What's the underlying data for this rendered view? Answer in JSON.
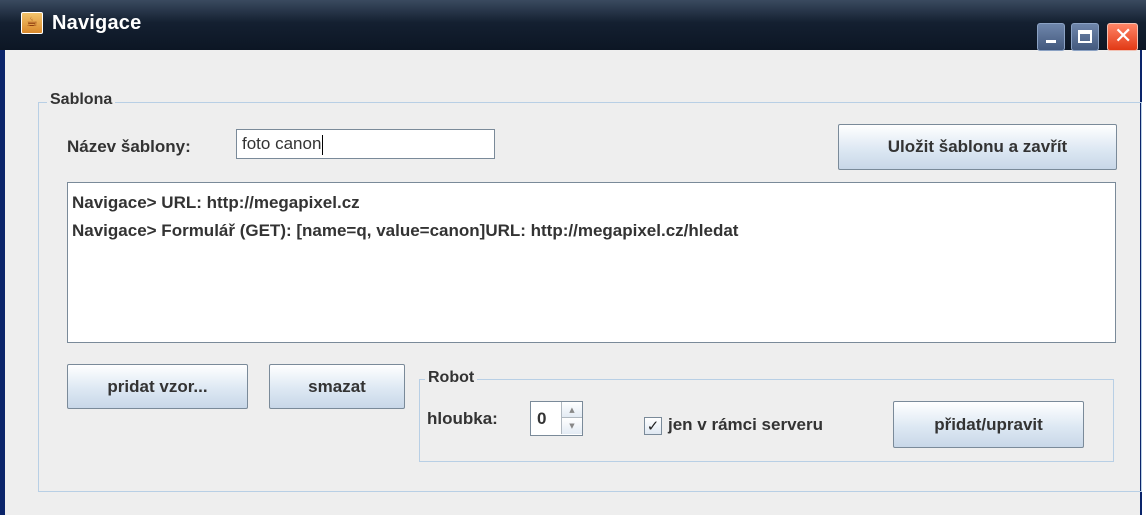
{
  "window": {
    "title": "Navigace",
    "app_icon": "java-cup-icon",
    "minimize_glyph": "",
    "close_glyph": "✕"
  },
  "sablona": {
    "legend": "Sablona",
    "name_label": "Název šablony:",
    "name_value": "foto canon",
    "save_button": "Uložit šablonu a zavřít",
    "log_lines": [
      "Navigace> URL: http://megapixel.cz",
      "Navigace> Formulář (GET): [name=q, value=canon]URL: http://megapixel.cz/hledat"
    ],
    "add_pattern_button": "pridat vzor...",
    "delete_button": "smazat"
  },
  "robot": {
    "legend": "Robot",
    "depth_label": "hloubka:",
    "depth_value": "0",
    "server_only_label": "jen v rámci serveru",
    "server_only_checked": true,
    "add_edit_button": "přidat/upravit"
  }
}
